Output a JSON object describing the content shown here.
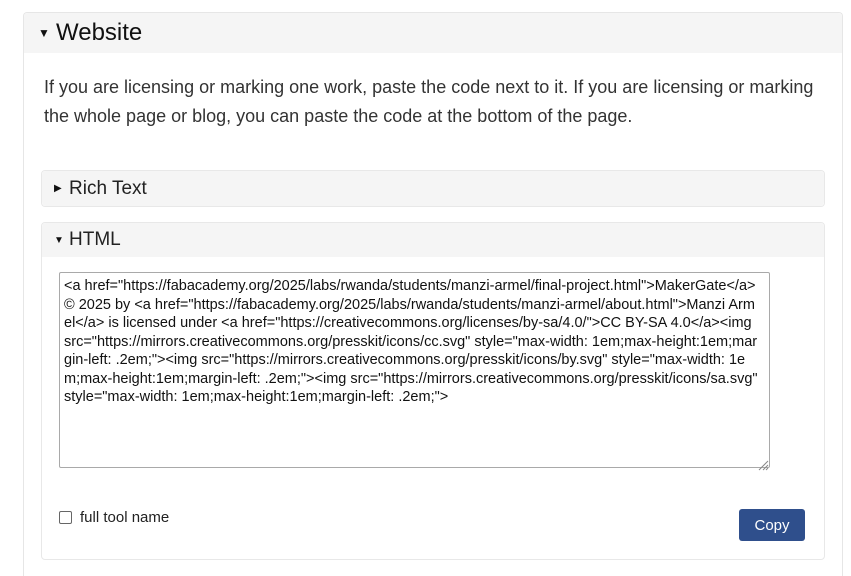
{
  "website_section": {
    "title": "Website",
    "caret": "▼",
    "intro": "If you are licensing or marking one work, paste the code next to it. If you are licensing or marking the whole page or blog, you can paste the code at the bottom of the page."
  },
  "rich_text_section": {
    "title": "Rich Text",
    "caret": "▶"
  },
  "html_section": {
    "title": "HTML",
    "caret": "▼",
    "code": "<a href=\"https://fabacademy.org/2025/labs/rwanda/students/manzi-armel/final-project.html\">MakerGate</a> © 2025 by <a href=\"https://fabacademy.org/2025/labs/rwanda/students/manzi-armel/about.html\">Manzi Armel</a> is licensed under <a href=\"https://creativecommons.org/licenses/by-sa/4.0/\">CC BY-SA 4.0</a><img src=\"https://mirrors.creativecommons.org/presskit/icons/cc.svg\" style=\"max-width: 1em;max-height:1em;margin-left: .2em;\"><img src=\"https://mirrors.creativecommons.org/presskit/icons/by.svg\" style=\"max-width: 1em;max-height:1em;margin-left: .2em;\"><img src=\"https://mirrors.creativecommons.org/presskit/icons/sa.svg\" style=\"max-width: 1em;max-height:1em;margin-left: .2em;\">",
    "checkbox_label": "full tool name",
    "checkbox_checked": false,
    "copy_label": "Copy"
  },
  "colors": {
    "header_bg": "#f5f5f5",
    "button_bg": "#2f4f8c",
    "button_text": "#ffffff"
  }
}
